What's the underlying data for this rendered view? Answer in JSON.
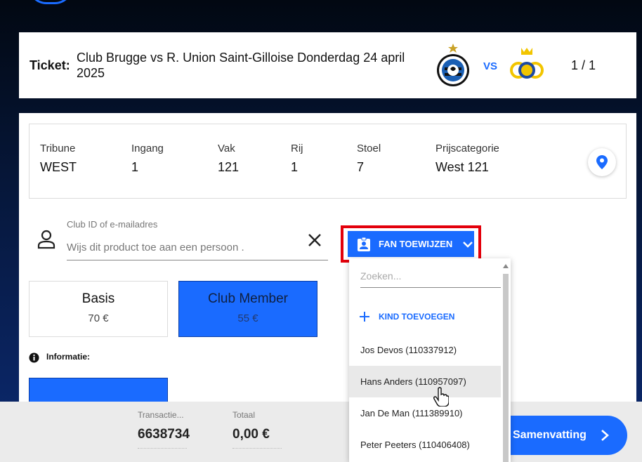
{
  "ticket": {
    "label": "Ticket:",
    "title": "Club Brugge vs R. Union Saint-Gilloise Donderdag 24 april 2025",
    "vs": "VS",
    "count": "1 / 1",
    "home_crest": "club-brugge-crest",
    "away_crest": "usg-crest"
  },
  "seat": {
    "columns": [
      {
        "label": "Tribune",
        "value": "WEST"
      },
      {
        "label": "Ingang",
        "value": "1"
      },
      {
        "label": "Vak",
        "value": "121"
      },
      {
        "label": "Rij",
        "value": "1"
      },
      {
        "label": "Stoel",
        "value": "7"
      },
      {
        "label": "Prijscategorie",
        "value": "West 121"
      }
    ],
    "map_icon": "location-pin-icon"
  },
  "assign": {
    "field_label": "Club ID of e-mailadres",
    "placeholder": "Wijs dit product toe aan een persoon .",
    "fan_button": "FAN TOEWIJZEN"
  },
  "prices": [
    {
      "name": "Basis",
      "price": "70 €",
      "active": false
    },
    {
      "name": "Club Member",
      "price": "55 €",
      "active": true
    }
  ],
  "info": {
    "label": "Informatie:"
  },
  "dropdown": {
    "search_placeholder": "Zoeken...",
    "add_child": "KIND TOEVOEGEN",
    "items": [
      "Jos Devos (110337912)",
      "Hans Anders (110957097)",
      "Jan De Man (111389910)",
      "Peter Peeters (110406408)"
    ],
    "hovered_index": 1
  },
  "footer": {
    "transaction_label": "Transactie...",
    "transaction_value": "6638734",
    "total_label": "Totaal",
    "total_value": "0,00 €",
    "summary_button": "Samenvatting"
  },
  "colors": {
    "accent": "#1a6bff",
    "highlight": "#e3000b",
    "footer_bg": "#ebebeb"
  }
}
